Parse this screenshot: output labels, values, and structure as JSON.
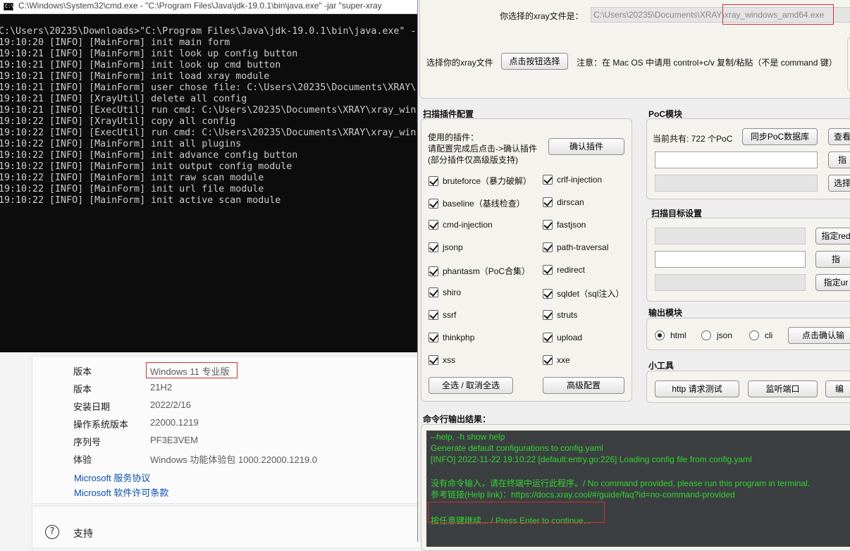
{
  "settings": {
    "rows": [
      {
        "label": "版本",
        "value": "Windows 11 专业版"
      },
      {
        "label": "版本",
        "value": "21H2"
      },
      {
        "label": "安装日期",
        "value": "2022/2/16"
      },
      {
        "label": "操作系统版本",
        "value": "22000.1219"
      },
      {
        "label": "序列号",
        "value": "PF3E3VEM"
      },
      {
        "label": "体验",
        "value": "Windows 功能体验包 1000.22000.1219.0"
      }
    ],
    "links": [
      "Microsoft 服务协议",
      "Microsoft 软件许可条款"
    ],
    "support_label": "支持",
    "support_icon": "?"
  },
  "cmd": {
    "title": "C:\\Windows\\System32\\cmd.exe - \"C:\\Program Files\\Java\\jdk-19.0.1\\bin\\java.exe\"  -jar \"super-xray",
    "icon_text": "C:\\",
    "lines": [
      "C:\\Users\\20235\\Downloads>\"C:\\Program Files\\Java\\jdk-19.0.1\\bin\\java.exe\" -",
      "19:10:20 [INFO] [MainForm] init main form",
      "19:10:21 [INFO] [MainForm] init look up config button",
      "19:10:21 [INFO] [MainForm] init look up cmd button",
      "19:10:21 [INFO] [MainForm] init load xray module",
      "19:10:21 [INFO] [MainForm] user chose file: C:\\Users\\20235\\Documents\\XRAY\\",
      "19:10:21 [INFO] [XrayUtil] delete all config",
      "19:10:21 [INFO] [ExecUtil] run cmd: C:\\Users\\20235\\Documents\\XRAY\\xray_win",
      "19:10:22 [INFO] [XrayUtil] copy all config",
      "19:10:22 [INFO] [ExecUtil] run cmd: C:\\Users\\20235\\Documents\\XRAY\\xray_win",
      "19:10:22 [INFO] [MainForm] init all plugins",
      "19:10:22 [INFO] [MainForm] init advance config button",
      "19:10:22 [INFO] [MainForm] init output config module",
      "19:10:22 [INFO] [MainForm] init raw scan module",
      "19:10:22 [INFO] [MainForm] init url file module",
      "19:10:22 [INFO] [MainForm] init active scan module"
    ]
  },
  "gui": {
    "xray_file_label": "你选择的xray文件是：",
    "xray_file_path": "C:\\Users\\20235\\Documents\\XRAY\\xray_windows_amd64.exe",
    "choose_label": "选择你的xray文件",
    "choose_button": "点击按钮选择",
    "choose_note": "注意：在 Mac OS 中请用 control+c/v 复制/粘贴（不是 command 键）",
    "plugins": {
      "title": "扫描插件配置",
      "desc": [
        "使用的插件：",
        "请配置完成后点击->确认插件",
        "(部分插件仅高级版支持)"
      ],
      "confirm_button": "确认插件",
      "items": [
        {
          "name": "bruteforce（暴力破解）",
          "checked": true
        },
        {
          "name": "crlf-injection",
          "checked": true
        },
        {
          "name": "baseline（基线检查）",
          "checked": true
        },
        {
          "name": "dirscan",
          "checked": true
        },
        {
          "name": "cmd-injection",
          "checked": true
        },
        {
          "name": "fastjson",
          "checked": true
        },
        {
          "name": "jsonp",
          "checked": true
        },
        {
          "name": "path-traversal",
          "checked": true
        },
        {
          "name": "phantasm（PoC合集）",
          "checked": true
        },
        {
          "name": "redirect",
          "checked": true
        },
        {
          "name": "shiro",
          "checked": true
        },
        {
          "name": "sqldet（sql注入）",
          "checked": true
        },
        {
          "name": "ssrf",
          "checked": true
        },
        {
          "name": "struts",
          "checked": true
        },
        {
          "name": "thinkphp",
          "checked": true
        },
        {
          "name": "upload",
          "checked": true
        },
        {
          "name": "xss",
          "checked": true
        },
        {
          "name": "xxe",
          "checked": true
        }
      ],
      "select_all_button": "全选 / 取消全选",
      "advanced_button": "高级配置"
    },
    "poc": {
      "title": "PoC模块",
      "count_text": "当前共有: 722 个PoC",
      "sync_button": "同步PoC数据库",
      "view_button": "查看",
      "btn2": "指",
      "btn3": "选择"
    },
    "target": {
      "title": "扫描目标设置",
      "btn1": "指定red",
      "btn2": "指",
      "btn3": "指定ur"
    },
    "output": {
      "title": "输出模块",
      "options": [
        {
          "label": "html",
          "selected": true
        },
        {
          "label": "json",
          "selected": false
        },
        {
          "label": "cli",
          "selected": false
        }
      ],
      "confirm_button": "点击确认输"
    },
    "tools": {
      "title": "小工具",
      "http_button": "http 请求测试",
      "listen_button": "监听端口",
      "edit_button": "编"
    },
    "console": {
      "title": "命令行输出结果：",
      "lines": [
        "   --help, -h        show help",
        "Generate default configurations to config.yaml",
        "[INFO] 2022-11-22 19:10:22 [default:entry.go:226] Loading config file from config.yaml",
        "",
        "没有命令输入，请在终端中运行此程序。/ No command provided, please run this program in terminal.",
        "参考链接(Help link)：https://docs.xray.cool/#/guide/faq?id=no-command-provided",
        "",
        "按任意键继续... / Press Enter to continue..."
      ]
    }
  }
}
